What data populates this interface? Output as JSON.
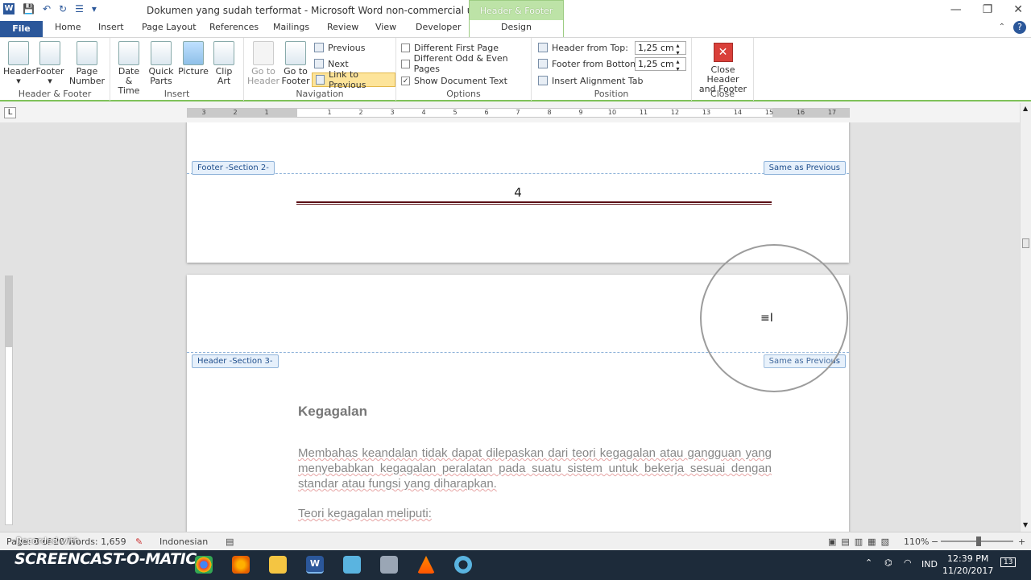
{
  "window": {
    "title": "Dokumen yang sudah terformat  -  Microsoft Word non-commercial use",
    "context_tab_group": "Header & Footer Tools",
    "controls": {
      "minimize": "—",
      "maximize": "❐",
      "close": "✕"
    }
  },
  "tabs": [
    "File",
    "Home",
    "Insert",
    "Page Layout",
    "References",
    "Mailings",
    "Review",
    "View",
    "Developer",
    "Design"
  ],
  "ribbon": {
    "groups": {
      "header_footer": {
        "label": "Header & Footer",
        "header": "Header",
        "footer": "Footer",
        "page_number_1": "Page",
        "page_number_2": "Number"
      },
      "insert": {
        "label": "Insert",
        "date_time_1": "Date",
        "date_time_2": "& Time",
        "quick_parts_1": "Quick",
        "quick_parts_2": "Parts",
        "picture": "Picture",
        "clip_art_1": "Clip",
        "clip_art_2": "Art"
      },
      "navigation": {
        "label": "Navigation",
        "go_to_header_1": "Go to",
        "go_to_header_2": "Header",
        "go_to_footer_1": "Go to",
        "go_to_footer_2": "Footer",
        "previous": "Previous",
        "next": "Next",
        "link_to_previous": "Link to Previous"
      },
      "options": {
        "label": "Options",
        "different_first_page": "Different First Page",
        "different_odd_even": "Different Odd & Even Pages",
        "show_document_text": "Show Document Text",
        "show_document_text_checked": "✓"
      },
      "position": {
        "label": "Position",
        "header_from_top": "Header from Top:",
        "header_from_top_value": "1,25 cm",
        "footer_from_bottom": "Footer from Bottom:",
        "footer_from_bottom_value": "1,25 cm",
        "insert_alignment_tab": "Insert Alignment Tab"
      },
      "close": {
        "label": "Close",
        "close_hf_1": "Close Header",
        "close_hf_2": "and Footer"
      }
    }
  },
  "ruler": {
    "corner": "L",
    "ticks": [
      "3",
      "2",
      "1",
      "1",
      "2",
      "3",
      "4",
      "5",
      "6",
      "7",
      "8",
      "9",
      "10",
      "11",
      "12",
      "13",
      "14",
      "15",
      "16",
      "17"
    ]
  },
  "document": {
    "footer_tag": "Footer -Section 2-",
    "footer_same_as_previous": "Same as Previous",
    "page_number": "4",
    "header_tag": "Header -Section 3-",
    "header_same_as_previous": "Same as Previous",
    "heading": "Kegagalan",
    "paragraph": "Membahas keandalan tidak dapat dilepaskan dari teori kegagalan atau gangguan yang menyebabkan kegagalan peralatan pada suatu sistem untuk bekerja sesuai dengan standar atau fungsi yang diharapkan.",
    "paragraph2": "Teori kegagalan meliputi:"
  },
  "statusbar": {
    "words": "Page: 8 of 20   Words: 1,659",
    "language": "Indonesian",
    "zoom": "110%",
    "zoom_out": "−",
    "zoom_in": "+"
  },
  "overlay": {
    "recorded_with": "Recorded with",
    "brand": "SCREENCAST-O-MATIC"
  },
  "taskbar": {
    "lang": "IND",
    "time": "12:39 PM",
    "date": "11/20/2017",
    "notifications": "13"
  },
  "colors": {
    "word_blue": "#2b579a",
    "hf_green": "#bde3a7",
    "footer_rule": "#5a0f14"
  }
}
